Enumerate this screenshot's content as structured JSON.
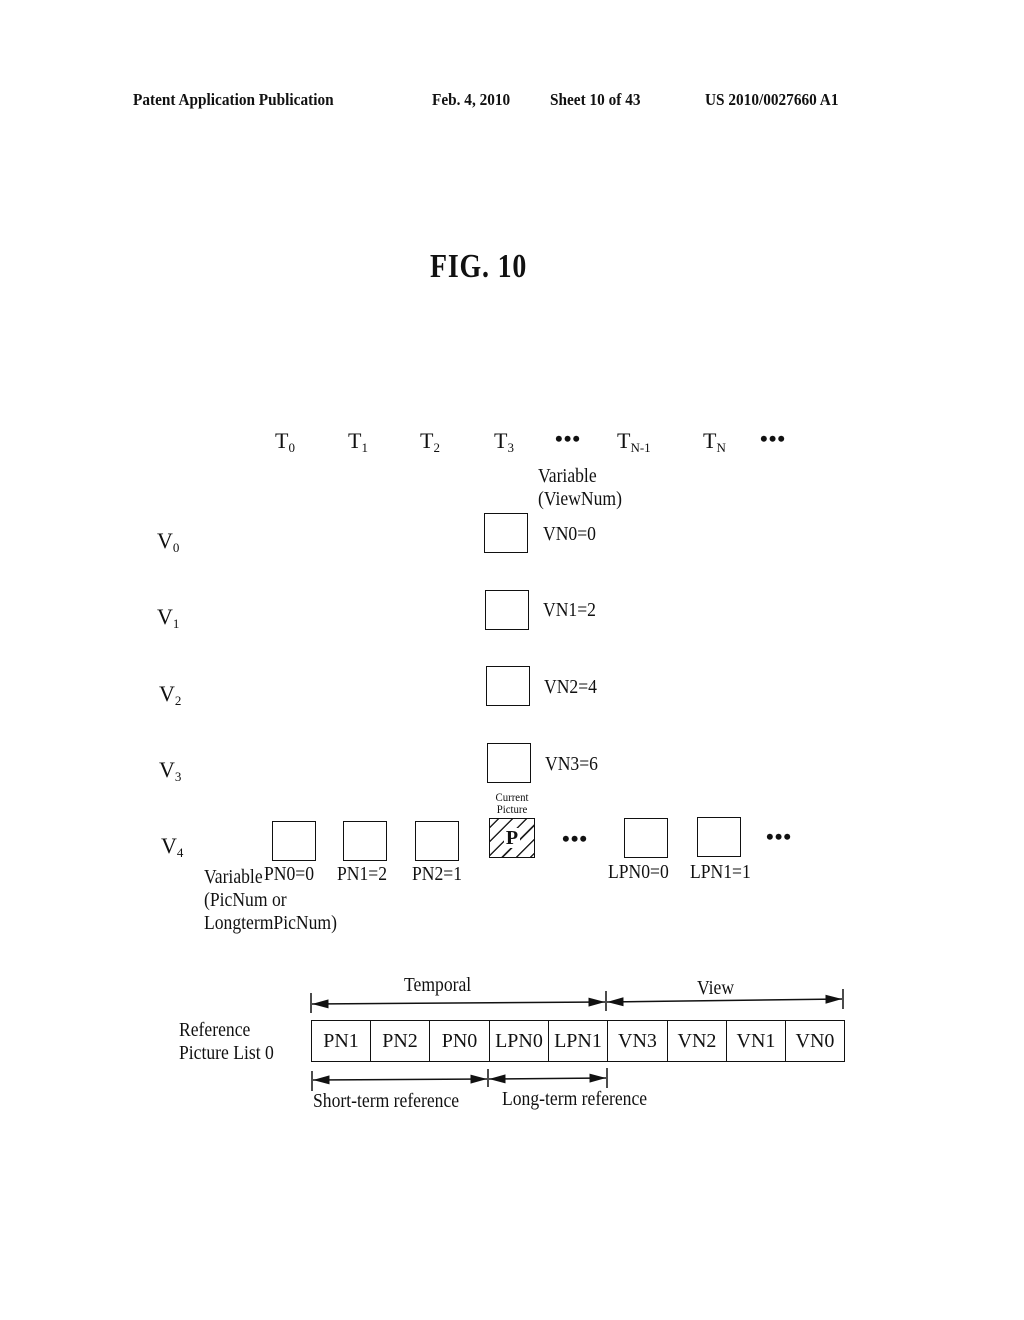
{
  "header": {
    "publication": "Patent Application Publication",
    "date": "Feb. 4, 2010",
    "sheet": "Sheet 10 of 43",
    "number": "US 2010/0027660 A1"
  },
  "figure": {
    "title": "FIG. 10"
  },
  "time_axis": {
    "labels": [
      {
        "base": "T",
        "sub": "0"
      },
      {
        "base": "T",
        "sub": "1"
      },
      {
        "base": "T",
        "sub": "2"
      },
      {
        "base": "T",
        "sub": "3"
      },
      {
        "base": "T",
        "sub": "N-1"
      },
      {
        "base": "T",
        "sub": "N"
      }
    ],
    "ellipsis": "•••"
  },
  "view_axis": {
    "labels": [
      {
        "base": "V",
        "sub": "0"
      },
      {
        "base": "V",
        "sub": "1"
      },
      {
        "base": "V",
        "sub": "2"
      },
      {
        "base": "V",
        "sub": "3"
      },
      {
        "base": "V",
        "sub": "4"
      }
    ]
  },
  "view_variable": {
    "title_line1": "Variable",
    "title_line2": "(ViewNum)",
    "values": [
      "VN0=0",
      "VN1=2",
      "VN2=4",
      "VN3=6"
    ]
  },
  "current_picture": {
    "label_line1": "Current",
    "label_line2": "Picture",
    "mark": "P"
  },
  "pic_variable": {
    "title_line1": "Variable",
    "title_line2": "(PicNum or",
    "title_line3": "LongtermPicNum)",
    "short_term": [
      "PN0=0",
      "PN1=2",
      "PN2=1"
    ],
    "long_term": [
      "LPN0=0",
      "LPN1=1"
    ],
    "ellipsis": "•••"
  },
  "reference_list": {
    "label_line1": "Reference",
    "label_line2": "Picture List 0",
    "entries": [
      "PN1",
      "PN2",
      "PN0",
      "LPN0",
      "LPN1",
      "VN3",
      "VN2",
      "VN1",
      "VN0"
    ],
    "spans": {
      "temporal": "Temporal",
      "view": "View",
      "short_term": "Short-term reference",
      "long_term": "Long-term reference"
    }
  }
}
